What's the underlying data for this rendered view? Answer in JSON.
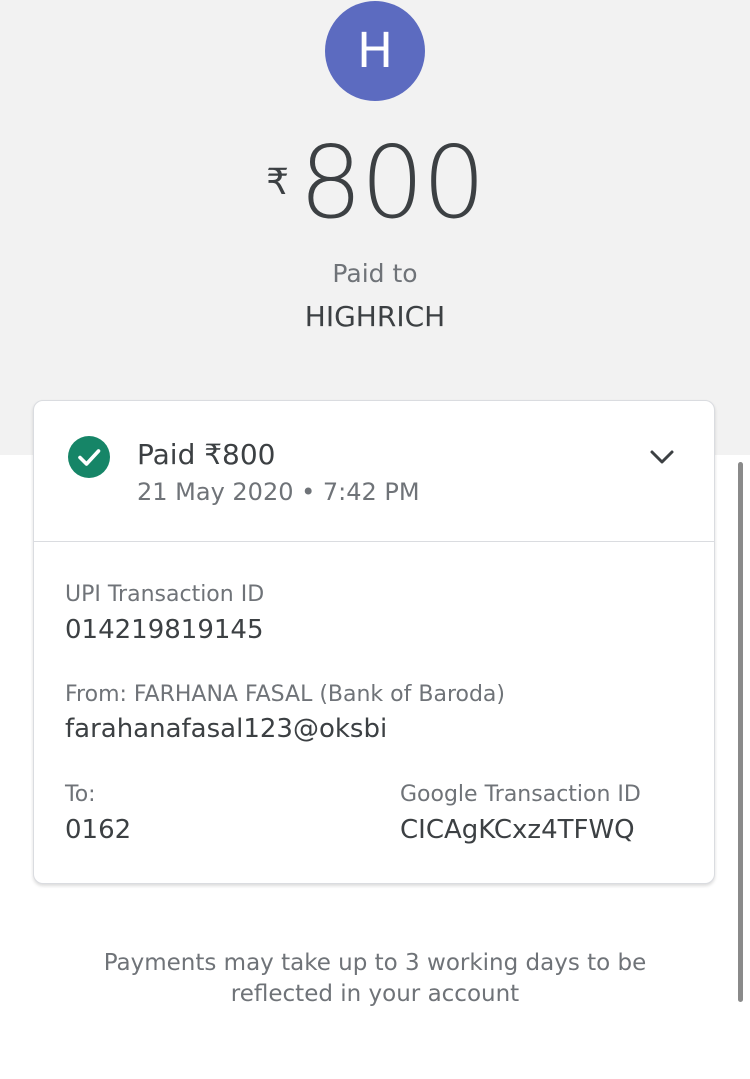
{
  "header": {
    "avatar_initial": "H",
    "currency_symbol": "₹",
    "amount": "800",
    "paid_to_label": "Paid to",
    "payee_name": "HIGHRICH"
  },
  "card": {
    "status_text": "Paid ₹800",
    "date_time": "21 May 2020 • 7:42 PM",
    "upi_label": "UPI Transaction ID",
    "upi_id": "014219819145",
    "from_label": "From: FARHANA FASAL (Bank of Baroda)",
    "from_vpa": "farahanafasal123@oksbi",
    "to_label": "To:",
    "to_value": "0162",
    "google_txn_label": "Google Transaction ID",
    "google_txn_id": "CICAgKCxz4TFWQ"
  },
  "footer": {
    "note": "Payments may take up to 3 working days to be reflected in your account"
  },
  "icons": {
    "status": "check-circle-icon",
    "expand": "chevron-down-icon"
  },
  "colors": {
    "avatar_bg": "#5c6bc0",
    "success_green": "#168567",
    "top_bg": "#f2f2f2"
  }
}
